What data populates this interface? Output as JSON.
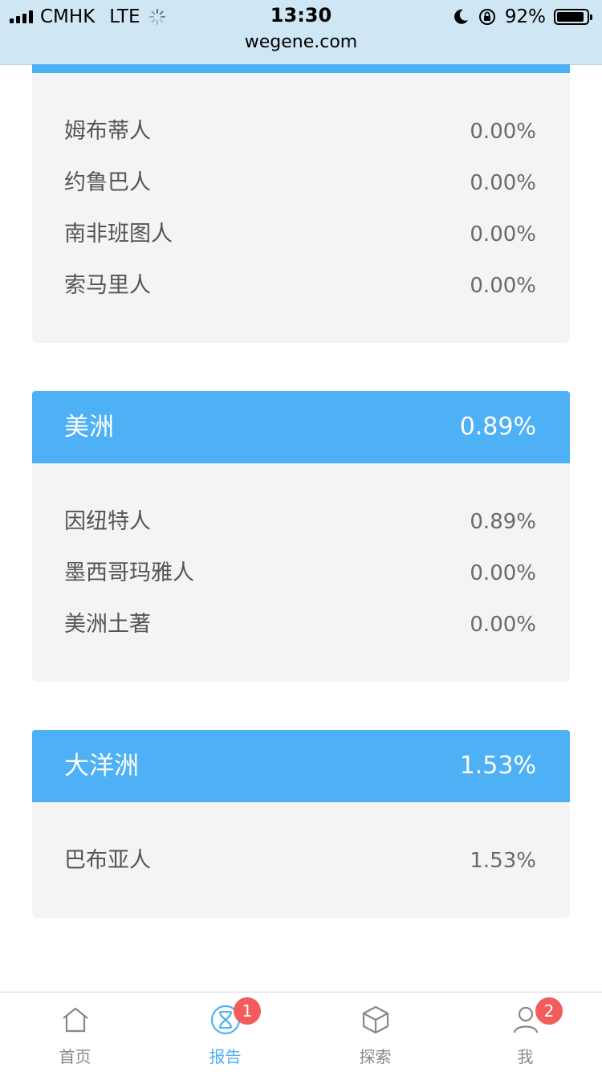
{
  "status_bar": {
    "carrier": "CMHK",
    "network": "LTE",
    "time": "13:30",
    "url": "wegene.com",
    "battery": "92%",
    "battery_level": 0.92
  },
  "regions": [
    {
      "name": "",
      "percent": "",
      "items": [
        {
          "name": "姆布蒂人",
          "percent": "0.00%"
        },
        {
          "name": "约鲁巴人",
          "percent": "0.00%"
        },
        {
          "name": "南非班图人",
          "percent": "0.00%"
        },
        {
          "name": "索马里人",
          "percent": "0.00%"
        }
      ]
    },
    {
      "name": "美洲",
      "percent": "0.89%",
      "items": [
        {
          "name": "因纽特人",
          "percent": "0.89%"
        },
        {
          "name": "墨西哥玛雅人",
          "percent": "0.00%"
        },
        {
          "name": "美洲土著",
          "percent": "0.00%"
        }
      ]
    },
    {
      "name": "大洋洲",
      "percent": "1.53%",
      "items": [
        {
          "name": "巴布亚人",
          "percent": "1.53%"
        }
      ]
    }
  ],
  "tabbar": {
    "tabs": [
      {
        "label": "首页",
        "icon": "home-icon",
        "badge": ""
      },
      {
        "label": "报告",
        "icon": "dna-report-icon",
        "badge": "1",
        "active": true
      },
      {
        "label": "探索",
        "icon": "cube-icon",
        "badge": ""
      },
      {
        "label": "我",
        "icon": "person-icon",
        "badge": "2"
      }
    ]
  },
  "colors": {
    "accent": "#4eb0f5",
    "card_bg": "#f4f4f4",
    "badge": "#f25c5c",
    "statusbar_bg": "#cfe6f5"
  }
}
